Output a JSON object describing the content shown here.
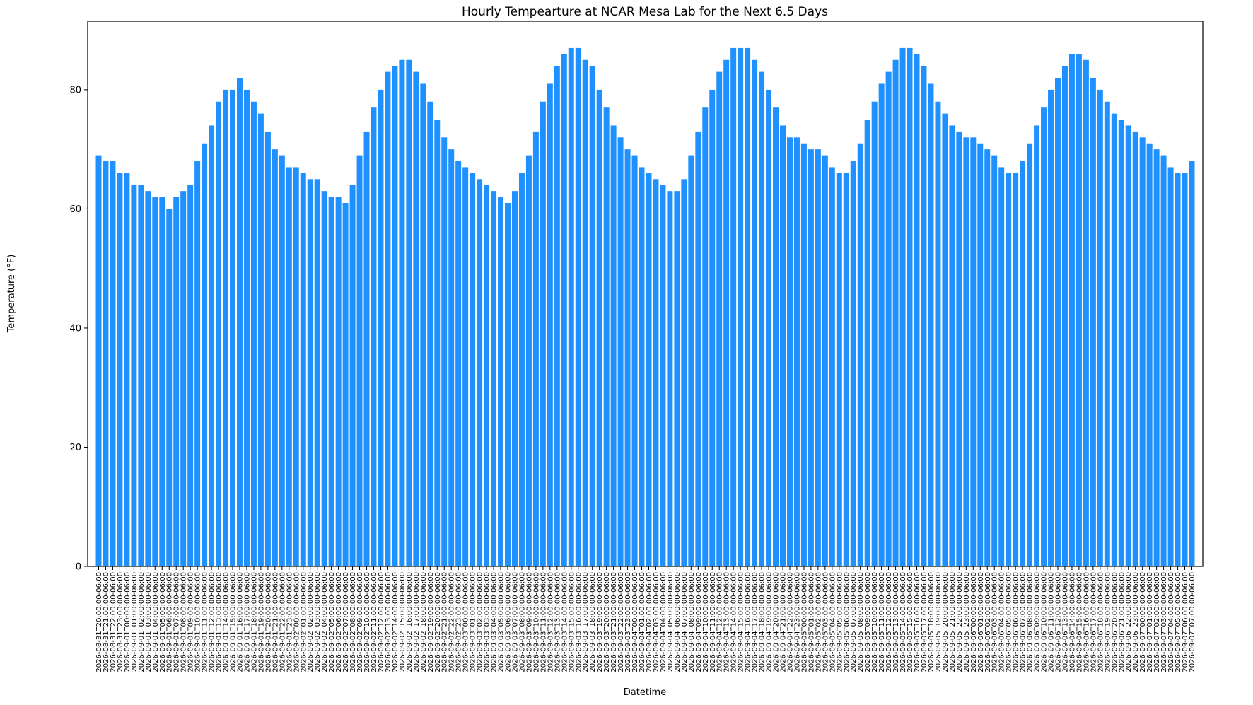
{
  "chart_data": {
    "type": "bar",
    "title": "Hourly Tempearture at NCAR Mesa Lab for the Next 6.5 Days",
    "xlabel": "Datetime",
    "ylabel": "Temperature (°F)",
    "ylim": [
      0,
      91.5
    ],
    "yticks": [
      0,
      20,
      40,
      60,
      80
    ],
    "grid": false,
    "bar_color": "#1e90ff",
    "x_label_start": "2026-08-31T20:00:00",
    "x_label_suffix": "-06:00",
    "values": [
      69,
      68,
      68,
      66,
      66,
      64,
      64,
      63,
      62,
      62,
      60,
      62,
      63,
      64,
      68,
      71,
      74,
      78,
      80,
      80,
      82,
      80,
      78,
      76,
      73,
      70,
      69,
      67,
      67,
      66,
      65,
      65,
      63,
      62,
      62,
      61,
      64,
      69,
      73,
      77,
      80,
      83,
      84,
      85,
      85,
      83,
      81,
      78,
      75,
      72,
      70,
      68,
      67,
      66,
      65,
      64,
      63,
      62,
      61,
      63,
      66,
      69,
      73,
      78,
      81,
      84,
      86,
      87,
      87,
      85,
      84,
      80,
      77,
      74,
      72,
      70,
      69,
      67,
      66,
      65,
      64,
      63,
      63,
      65,
      69,
      73,
      77,
      80,
      83,
      85,
      87,
      87,
      87,
      85,
      83,
      80,
      77,
      74,
      72,
      72,
      71,
      70,
      70,
      69,
      67,
      66,
      66,
      68,
      71,
      75,
      78,
      81,
      83,
      85,
      87,
      87,
      86,
      84,
      81,
      78,
      76,
      74,
      73,
      72,
      72,
      71,
      70,
      69,
      67,
      66,
      66,
      68,
      71,
      74,
      77,
      80,
      82,
      84,
      86,
      86,
      85,
      82,
      80,
      78,
      76,
      75,
      74,
      73,
      72,
      71,
      70,
      69,
      67,
      66,
      66,
      68
    ]
  }
}
